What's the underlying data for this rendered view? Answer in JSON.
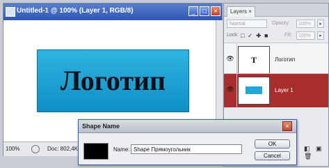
{
  "document": {
    "title": "Untitled-1 @ 100% (Layer 1, RGB/8)",
    "canvas_text": "Логотип",
    "status": {
      "zoom": "100%",
      "doc_info": "Doc: 802,4K/1,2M"
    },
    "window_buttons": {
      "minimize": "_",
      "maximize": "□",
      "close": "×"
    },
    "colors": {
      "logo_fill": "#1aa3d6",
      "titlebar": "#3b63bd"
    }
  },
  "layers_panel": {
    "tab": "Layers ×",
    "blend_mode": "Normal",
    "opacity_label": "Opacity:",
    "opacity_value": "100%",
    "lock_label": "Lock:",
    "lock_icons": "□ ✓ ✚ ■",
    "fill_label": "Fill:",
    "fill_value": "100%",
    "layers": [
      {
        "name": "Логотип",
        "thumb": "T",
        "selected": false
      },
      {
        "name": "Layer 1",
        "selected": true
      }
    ],
    "bottom_icons": "◧ ▣ 🗑"
  },
  "dialog": {
    "title": "Shape Name",
    "close": "×",
    "name_label": "Name:",
    "name_value": "Shape Прямоугольник",
    "ok": "OK",
    "cancel": "Cancel",
    "swatch_color": "#000000"
  }
}
